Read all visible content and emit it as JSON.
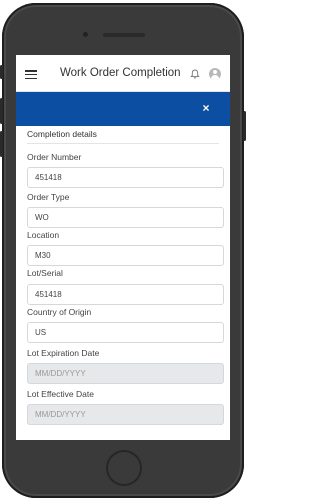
{
  "header": {
    "title": "Work Order Completion"
  },
  "icons": {
    "menu": "hamburger-menu-icon",
    "notifications": "bell-icon",
    "profile": "user-avatar-icon",
    "close": "close-icon"
  },
  "colors": {
    "modal_header": "#0b4ea2",
    "disabled_field": "#e6e8ea"
  },
  "modal": {
    "close_label": "×"
  },
  "form": {
    "section_title": "Completion details",
    "fields": [
      {
        "label": "Order Number",
        "value": "451418"
      },
      {
        "label": "Order Type",
        "value": "WO"
      },
      {
        "label": "Location",
        "value": "M30"
      },
      {
        "label": "Lot/Serial",
        "value": "451418"
      },
      {
        "label": "Country of Origin",
        "value": "US"
      },
      {
        "label": "Lot Expiration Date",
        "placeholder": "MM/DD/YYYY"
      },
      {
        "label": "Lot Effective Date",
        "placeholder": "MM/DD/YYYY"
      }
    ]
  }
}
